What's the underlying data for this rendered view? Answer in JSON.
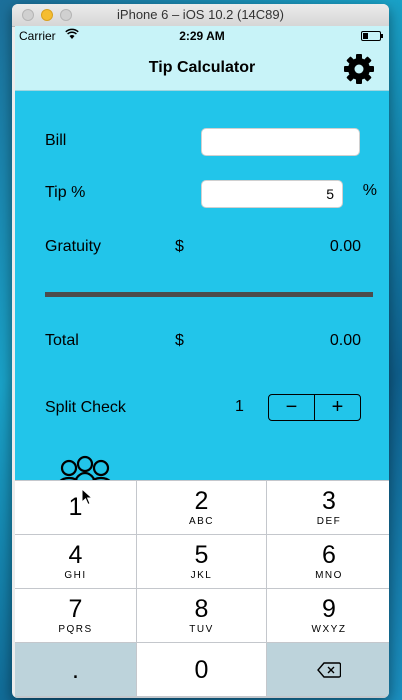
{
  "window": {
    "title": "iPhone 6 – iOS 10.2 (14C89)"
  },
  "status_bar": {
    "carrier": "Carrier",
    "time": "2:29 AM"
  },
  "nav": {
    "title": "Tip Calculator",
    "settings_icon": "gear-icon"
  },
  "form": {
    "bill_label": "Bill",
    "bill_value": "",
    "tip_label": "Tip %",
    "tip_value": "5",
    "tip_suffix": "%",
    "gratuity_label": "Gratuity",
    "gratuity_currency": "$",
    "gratuity_value": "0.00",
    "total_label": "Total",
    "total_currency": "$",
    "total_value": "0.00",
    "split_label": "Split Check",
    "split_value": "1",
    "minus_label": "−",
    "plus_label": "+"
  },
  "keyboard": {
    "keys": [
      {
        "num": "1",
        "letters": ""
      },
      {
        "num": "2",
        "letters": "ABC"
      },
      {
        "num": "3",
        "letters": "DEF"
      },
      {
        "num": "4",
        "letters": "GHI"
      },
      {
        "num": "5",
        "letters": "JKL"
      },
      {
        "num": "6",
        "letters": "MNO"
      },
      {
        "num": "7",
        "letters": "PQRS"
      },
      {
        "num": "8",
        "letters": "TUV"
      },
      {
        "num": "9",
        "letters": "WXYZ"
      }
    ],
    "decimal": ".",
    "zero": "0"
  },
  "colors": {
    "app_background": "#22c5ea",
    "navbar": "#c8f3f8",
    "divider": "#4c4c4c"
  }
}
